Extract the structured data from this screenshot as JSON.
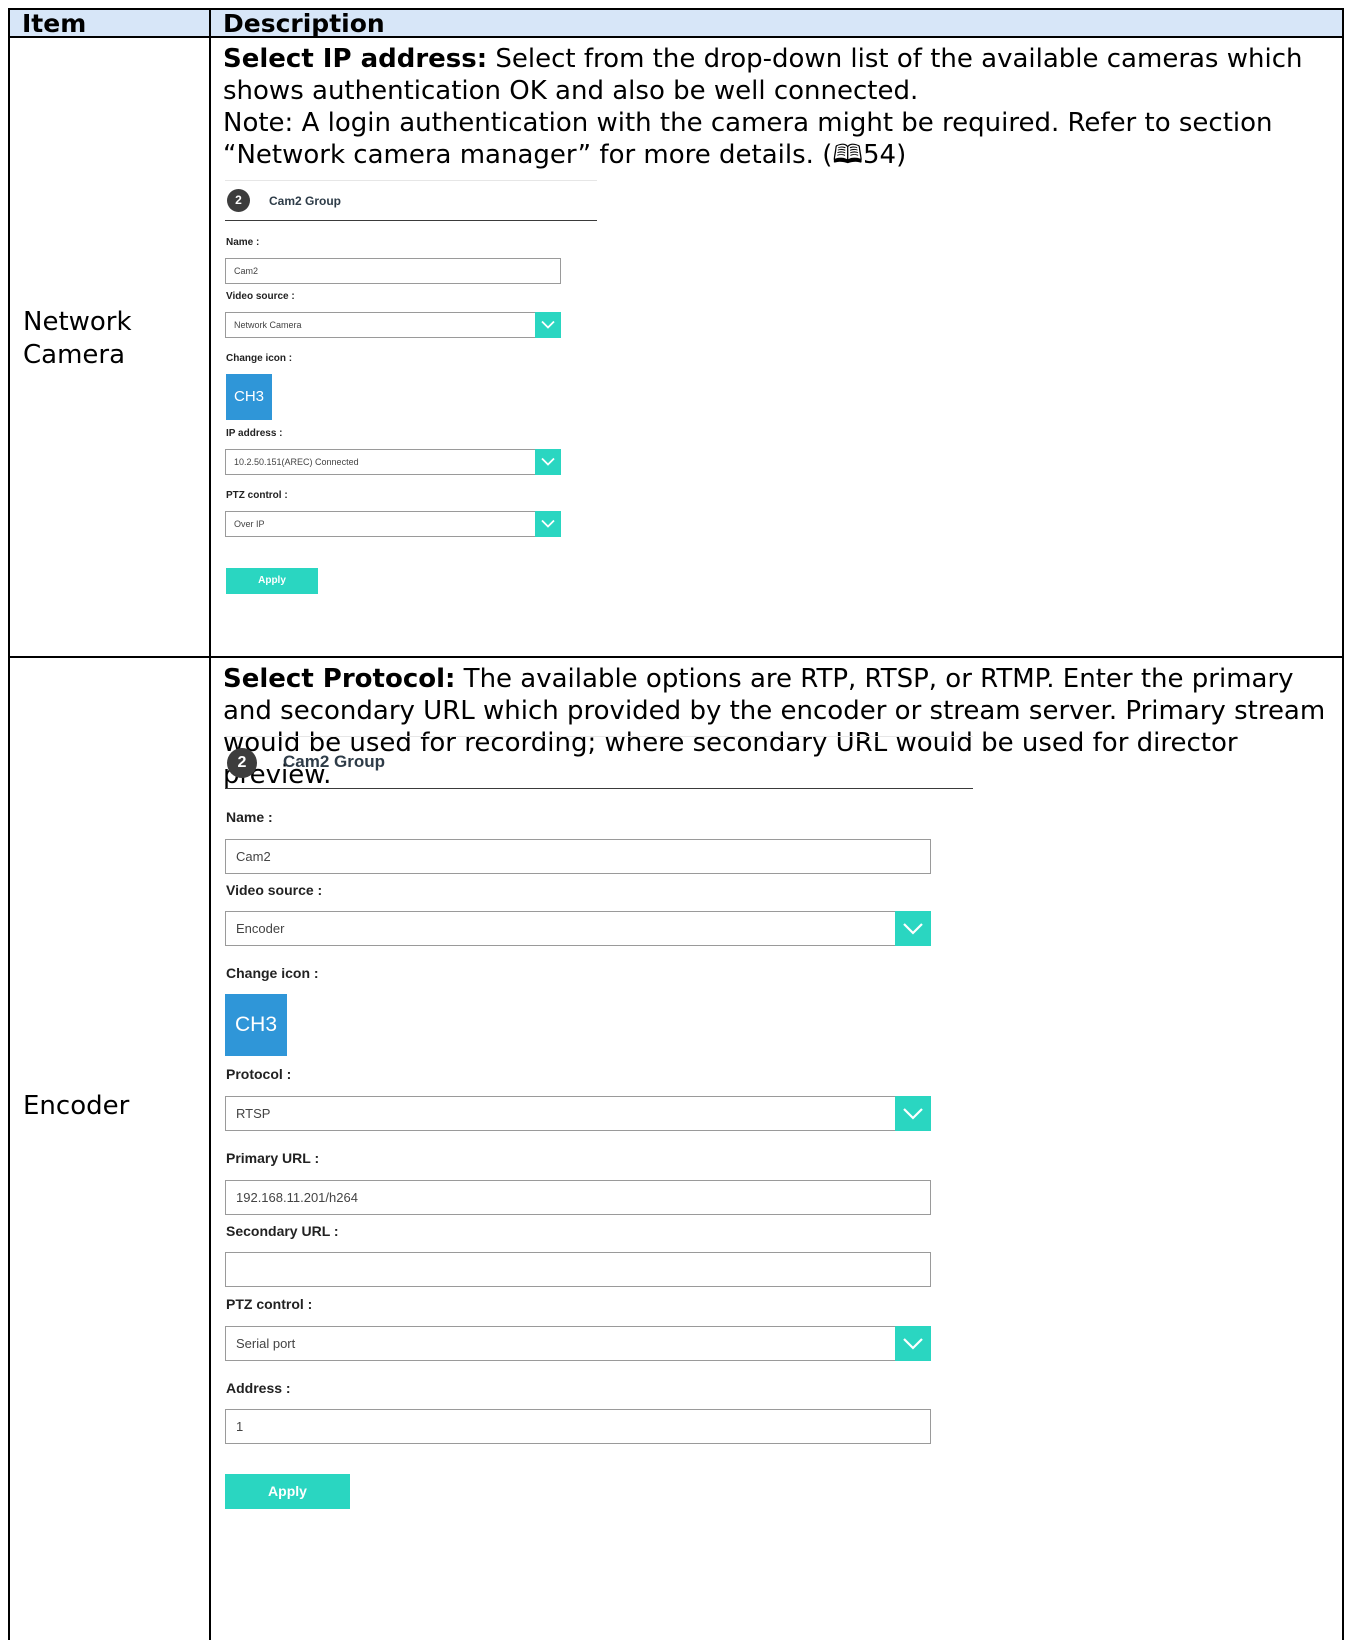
{
  "table": {
    "header_item": "Item",
    "header_description": "Description",
    "rows": [
      {
        "item": [
          "Network",
          "Camera"
        ],
        "desc_bold": "Select IP address:",
        "desc_text": " Select from the drop-down list of the available cameras which shows authentication OK and also be well connected.",
        "note": "Note: A login authentication with the camera might be required. Refer to section “Network camera manager” for more details. (🕮54)",
        "form": {
          "group_number": "2",
          "group_title": "Cam2 Group",
          "name_label": "Name :",
          "name_value": "Cam2",
          "video_source_label": "Video source :",
          "video_source_value": "Network Camera",
          "change_icon_label": "Change icon :",
          "icon_text": "CH3",
          "ip_label": "IP address :",
          "ip_value": "10.2.50.151(AREC) Connected",
          "ptz_label": "PTZ control :",
          "ptz_value": "Over IP",
          "apply_label": "Apply"
        }
      },
      {
        "item": [
          "Encoder"
        ],
        "desc_bold": "Select Protocol:",
        "desc_text": " The available options are RTP, RTSP, or RTMP. Enter the primary and secondary URL which provided by the encoder or stream server. Primary stream would be used for recording; where secondary URL would be used for director preview.",
        "form": {
          "group_number": "2",
          "group_title": "Cam2 Group",
          "name_label": "Name :",
          "name_value": "Cam2",
          "video_source_label": "Video source :",
          "video_source_value": "Encoder",
          "change_icon_label": "Change icon :",
          "icon_text": "CH3",
          "protocol_label": "Protocol :",
          "protocol_value": "RTSP",
          "primary_url_label": "Primary URL :",
          "primary_url_value": "192.168.11.201/h264",
          "secondary_url_label": "Secondary URL :",
          "secondary_url_value": "",
          "ptz_label": "PTZ control :",
          "ptz_value": "Serial port",
          "address_label": "Address :",
          "address_value": "1",
          "apply_label": "Apply"
        }
      }
    ]
  },
  "colors": {
    "header_bg": "#d7e6f8",
    "accent_teal": "#2ad6c1",
    "icon_blue": "#2f96d8"
  },
  "icons": [
    "chevron-down-icon"
  ]
}
